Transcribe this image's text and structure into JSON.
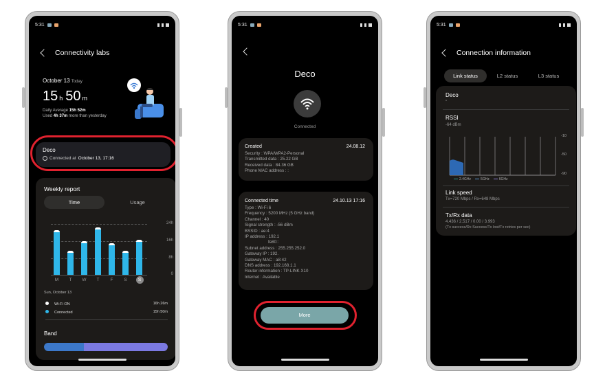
{
  "status_time": "5:31",
  "p1": {
    "title": "Connectivity labs",
    "date_label": "October 13",
    "today_label": "Today",
    "hours": "15",
    "h_unit": "h",
    "minutes": "50",
    "m_unit": "m",
    "daily_avg_label": "Daily Average",
    "daily_avg_value": "15h 52m",
    "used_prefix": "Used",
    "used_value": "4h 37m",
    "used_suffix": "more than yesterday",
    "conn_name": "Deco",
    "conn_prefix": "Connected at",
    "conn_time": "October 13, 17:16",
    "weekly_title": "Weekly report",
    "tab_time": "Time",
    "tab_usage": "Usage",
    "y_labels": [
      "24h",
      "16h",
      "8h",
      "0"
    ],
    "days": [
      "M",
      "T",
      "W",
      "T",
      "F",
      "S",
      "S"
    ],
    "bar_values_h": [
      21,
      11.5,
      16,
      22.5,
      15,
      11.5,
      16.5
    ],
    "chart_caption": "Sun, October 13",
    "legend": [
      {
        "label": "Wi-Fi ON",
        "value": "16h 26m",
        "color": "#ffffff"
      },
      {
        "label": "Connected",
        "value": "15h 50m",
        "color": "#2fb7ea"
      }
    ],
    "band_title": "Band",
    "band_colors": [
      "#3c78c9",
      "#7b79e1"
    ]
  },
  "p2": {
    "title": "Deco",
    "connected_label": "Connected",
    "created_title": "Created",
    "created_date": "24.08.12",
    "created_lines": [
      "Security : WPA/WPA2-Personal",
      "Transmitted data : 25.22 GB",
      "Received data : 84.36 GB",
      "Phone MAC address : :"
    ],
    "conn_title": "Connected time",
    "conn_date": "24.10.13 17:16",
    "conn_lines": [
      "Type : Wi-Fi 6",
      "Frequency : 5200 MHz (5 GHz band)",
      "Channel : 40",
      "Signal strength : -56 dBm",
      "BSSID : ae:4",
      "IP address : 192.1",
      "fe80::",
      "Subnet address : 255.255.252.0",
      "Gateway IP : 192.",
      "Gateway MAC : a8:42",
      "DNS address : 192.168.1.1",
      "Router information : TP-LINK X10",
      "Internet : Available"
    ],
    "more_button": "More"
  },
  "p3": {
    "title": "Connection information",
    "tabs": [
      "Link status",
      "L2 status",
      "L3 status"
    ],
    "deco_title": "Deco",
    "deco_sub": "\"",
    "rssi_title": "RSSI",
    "rssi_value": "-64 dBm",
    "rssi_y_labels": [
      "-10",
      "-50",
      "-90"
    ],
    "rssi_legend": [
      "2.4GHz",
      "5GHz",
      "6GHz"
    ],
    "rssi_legend_colors": [
      "#2d9b8e",
      "#5b9bd5",
      "#8b7ed6"
    ],
    "link_title": "Link speed",
    "link_value": "Tx=720 Mbps / Rx=648 Mbps",
    "txrx_title": "Tx/Rx data",
    "txrx_value": "4.436 / 2.517 / 0.00 / 3.993",
    "txrx_note": "(Tx success/Rx Success/Tx lost/Tx retries per sec)"
  }
}
